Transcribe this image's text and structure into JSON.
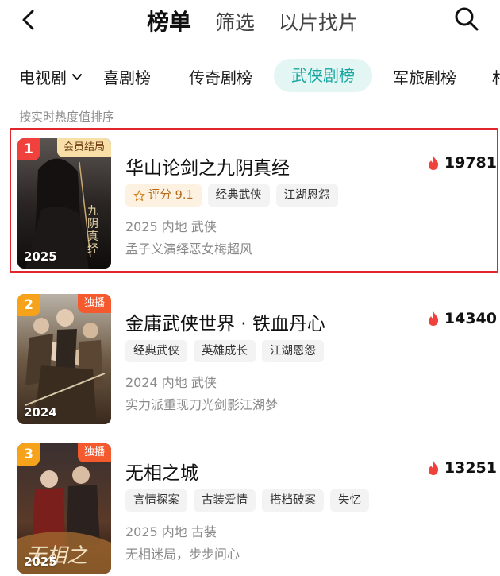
{
  "header": {
    "tabs": [
      {
        "label": "榜单",
        "active": true
      },
      {
        "label": "筛选",
        "active": false
      },
      {
        "label": "以片找片",
        "active": false
      }
    ],
    "back_icon": "chevron-left-icon",
    "search_icon": "search-icon"
  },
  "categories": {
    "dropdown_label": "电视剧",
    "items": [
      {
        "label": "喜剧榜",
        "active": false
      },
      {
        "label": "传奇剧榜",
        "active": false
      },
      {
        "label": "武侠剧榜",
        "active": true
      },
      {
        "label": "军旅剧榜",
        "active": false
      },
      {
        "label": "札",
        "active": false
      }
    ],
    "accent_color": "#18a7a0"
  },
  "sort_hint": "按实时热度值排序",
  "list": [
    {
      "rank": "1",
      "badge": "会员结局",
      "poster_year": "2025",
      "title": "华山论剑之九阴真经",
      "heat": "19781",
      "rating": "评分 9.1",
      "tags": [
        "经典武侠",
        "江湖恩怨"
      ],
      "meta": "2025 内地 武侠",
      "desc": "孟子义演绎恶女梅超风",
      "highlighted": true
    },
    {
      "rank": "2",
      "badge": "独播",
      "poster_year": "2024",
      "title": "金庸武侠世界 · 铁血丹心",
      "heat": "14340",
      "tags": [
        "经典武侠",
        "英雄成长",
        "江湖恩怨"
      ],
      "meta": "2024 内地 武侠",
      "desc": "实力派重现刀光剑影江湖梦"
    },
    {
      "rank": "3",
      "badge": "独播",
      "poster_year": "2025",
      "title": "无相之城",
      "heat": "13251",
      "tags": [
        "言情探案",
        "古装爱情",
        "搭档破案",
        "失忆"
      ],
      "meta": "2025 内地 古装",
      "desc": "无相迷局，步步问心"
    }
  ],
  "colors": {
    "rank1": "#f0413d",
    "rank_other": "#f7a21b",
    "heat_flame": "#f0413d",
    "highlight_border": "#e0252b"
  }
}
